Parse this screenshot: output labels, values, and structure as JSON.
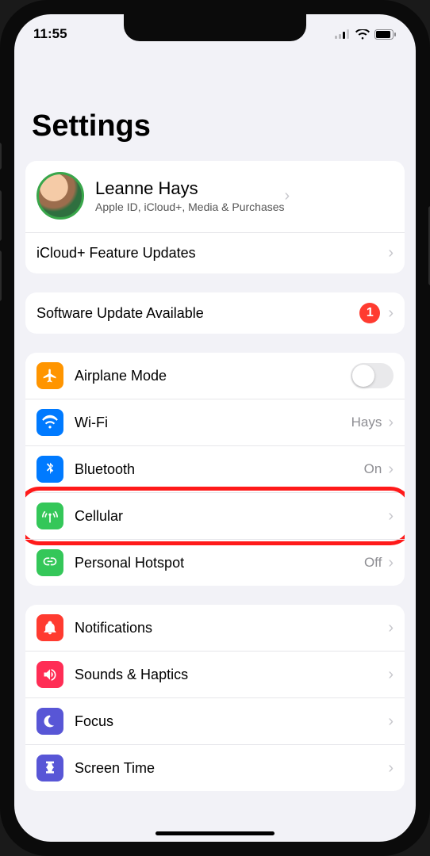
{
  "status": {
    "time": "11:55"
  },
  "title": "Settings",
  "profile": {
    "name": "Leanne Hays",
    "subtitle": "Apple ID, iCloud+, Media & Purchases",
    "updates_label": "iCloud+ Feature Updates"
  },
  "software_update": {
    "label": "Software Update Available",
    "badge": "1"
  },
  "network": {
    "airplane_label": "Airplane Mode",
    "wifi_label": "Wi-Fi",
    "wifi_value": "Hays",
    "bt_label": "Bluetooth",
    "bt_value": "On",
    "cell_label": "Cellular",
    "hotspot_label": "Personal Hotspot",
    "hotspot_value": "Off"
  },
  "general": {
    "notifications_label": "Notifications",
    "sounds_label": "Sounds & Haptics",
    "focus_label": "Focus",
    "screentime_label": "Screen Time"
  },
  "icons": {
    "airplane_bg": "#ff9500",
    "wifi_bg": "#007aff",
    "bt_bg": "#007aff",
    "cell_bg": "#34c759",
    "hotspot_bg": "#34c759",
    "notif_bg": "#ff3b30",
    "sounds_bg": "#ff2d55",
    "focus_bg": "#5856d6",
    "screentime_bg": "#5856d6"
  }
}
